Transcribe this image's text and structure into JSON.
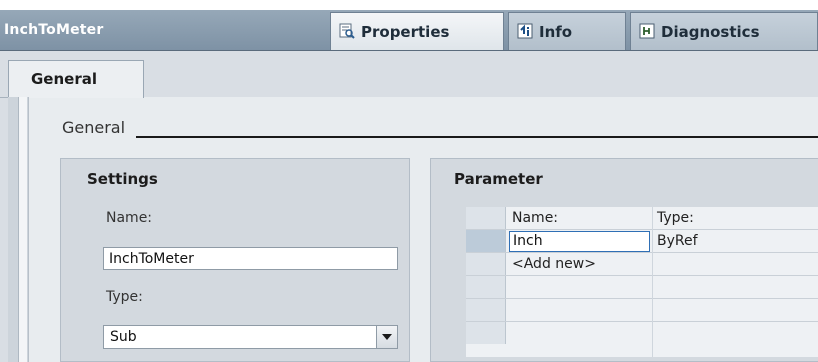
{
  "window": {
    "title": "InchToMeter"
  },
  "top_tabs": [
    {
      "label": "Properties",
      "icon": "properties-icon",
      "active": true
    },
    {
      "label": "Info",
      "icon": "info-icon",
      "active": false
    },
    {
      "label": "Diagnostics",
      "icon": "diagnostics-icon",
      "active": false
    }
  ],
  "sub_tabs": [
    {
      "label": "General",
      "active": true
    }
  ],
  "section": {
    "heading": "General"
  },
  "settings": {
    "title": "Settings",
    "name_label": "Name:",
    "name_value": "InchToMeter",
    "type_label": "Type:",
    "type_value": "Sub"
  },
  "parameter": {
    "title": "Parameter",
    "columns": [
      "Name:",
      "Type:"
    ],
    "rows": [
      {
        "name": "Inch",
        "type": "ByRef"
      },
      {
        "name": "<Add new>",
        "type": ""
      }
    ]
  },
  "colors": {
    "titlebar": "#7e92a5",
    "panel": "#d3d9df",
    "selection": "#2f6fb5"
  }
}
